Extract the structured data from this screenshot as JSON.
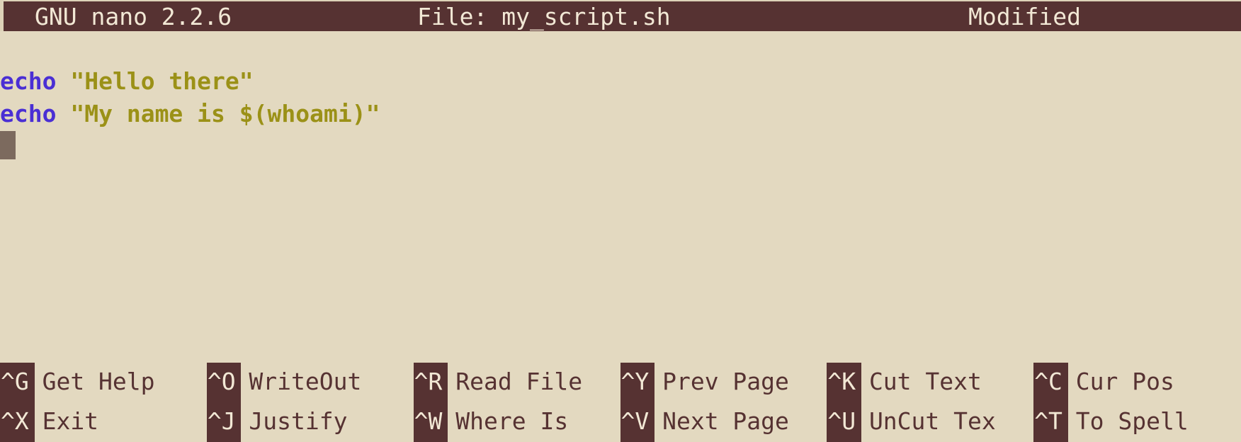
{
  "window": {
    "app": "GNU nano",
    "colors": {
      "background": "#e3d9c0",
      "titlebar_bg": "#563232",
      "titlebar_fg": "#f2e8d5",
      "keyword": "#4a2fd4",
      "string": "#9b9117",
      "cursor": "#7c6a5e",
      "shortcut_text": "#563232"
    }
  },
  "titlebar": {
    "version": "GNU nano 2.2.6",
    "file_label": "File: my_script.sh",
    "status": "Modified"
  },
  "editor": {
    "lines": [
      {
        "index": 0,
        "tokens": [
          {
            "type": "keyword",
            "text": "echo"
          },
          {
            "type": "plain",
            "text": " "
          },
          {
            "type": "string",
            "text": "\"Hello there\""
          }
        ],
        "plain": "echo \"Hello there\""
      },
      {
        "index": 1,
        "tokens": [
          {
            "type": "keyword",
            "text": "echo"
          },
          {
            "type": "plain",
            "text": " "
          },
          {
            "type": "string",
            "text": "\"My name is $(whoami)\""
          }
        ],
        "plain": "echo \"My name is $(whoami)\""
      },
      {
        "index": 2,
        "tokens": [],
        "plain": ""
      }
    ],
    "cursor": {
      "row": 2,
      "col": 0
    }
  },
  "shortcuts": {
    "rows": [
      [
        {
          "key": "^G",
          "label": "Get Help",
          "col": 0
        },
        {
          "key": "^O",
          "label": "WriteOut",
          "col": 12
        },
        {
          "key": "^R",
          "label": "Read File",
          "col": 24
        },
        {
          "key": "^Y",
          "label": "Prev Page",
          "col": 36
        },
        {
          "key": "^K",
          "label": "Cut Text",
          "col": 48
        },
        {
          "key": "^C",
          "label": "Cur Pos",
          "col": 60
        }
      ],
      [
        {
          "key": "^X",
          "label": "Exit",
          "col": 0
        },
        {
          "key": "^J",
          "label": "Justify",
          "col": 12
        },
        {
          "key": "^W",
          "label": "Where Is",
          "col": 24
        },
        {
          "key": "^V",
          "label": "Next Page",
          "col": 36
        },
        {
          "key": "^U",
          "label": "UnCut Tex",
          "col": 48
        },
        {
          "key": "^T",
          "label": "To Spell",
          "col": 60
        }
      ]
    ]
  }
}
